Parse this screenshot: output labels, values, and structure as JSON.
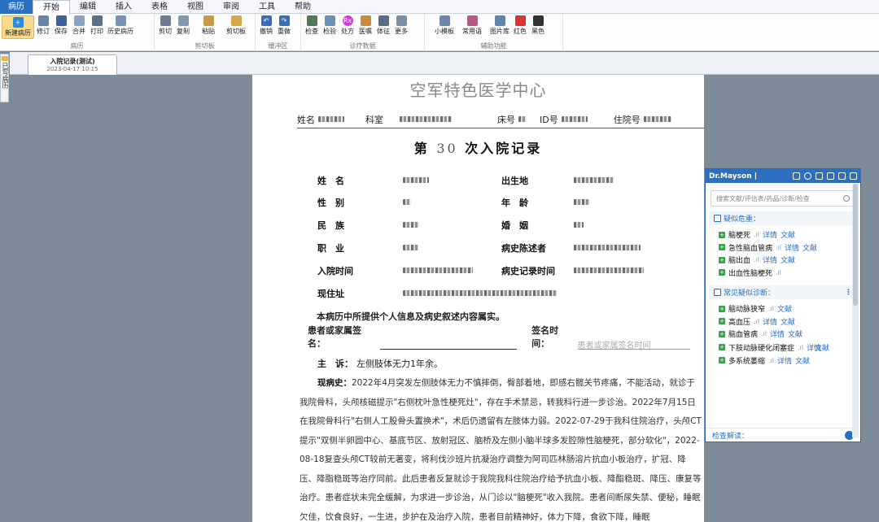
{
  "menubar": {
    "file_tab": "病历",
    "menus": [
      "开始",
      "编辑",
      "插入",
      "表格",
      "视图",
      "审阅",
      "工具",
      "帮助"
    ]
  },
  "ribbon": {
    "groups": [
      {
        "label": "病历",
        "buttons": [
          "新建病历",
          "修订",
          "保存",
          "合并",
          "打印",
          "历史病历"
        ]
      },
      {
        "label": "剪切板",
        "buttons": [
          "剪切",
          "复制",
          "粘贴",
          "剪切板"
        ]
      },
      {
        "label": "缓冲区",
        "buttons": [
          "撤销",
          "重做"
        ]
      },
      {
        "label": "诊疗数据",
        "buttons": [
          "检查",
          "检验",
          "处方",
          "医嘱",
          "体征",
          "更多"
        ]
      },
      {
        "label": "辅助功能",
        "buttons": [
          "小模板",
          "常用语",
          "图片库",
          "红色",
          "黑色"
        ]
      }
    ]
  },
  "left_tab": {
    "label": "已写病历"
  },
  "doc_tab": {
    "title": "入院记录(测试)",
    "subtitle": "2023-04-17 10:15"
  },
  "document": {
    "hospital": "空军特色医学中心",
    "info_labels": {
      "name": "姓名",
      "dept": "科室",
      "bed": "床号",
      "id": "ID号",
      "inpatient": "住院号"
    },
    "admit_title_prefix": "第",
    "admit_number": "30",
    "admit_title_suffix": "次入院记录",
    "fields_left": [
      "姓　名",
      "性　别",
      "民　族",
      "职　业",
      "入院时间",
      "现住址"
    ],
    "fields_right": [
      "出生地",
      "年　龄",
      "婚　姻",
      "病史陈述者",
      "病史记录时间"
    ],
    "declaration": "本病历中所提供个人信息及病史叙述内容属实。",
    "sign_label": "患者或家属签名：",
    "sign_time_label": "签名时间：",
    "sign_time_placeholder": "患者或家属签名时间",
    "chief_label": "主　诉：",
    "chief_value": "左侧肢体无力1年余。",
    "history_label": "现病史：",
    "history_text": "2022年4月突发左侧肢体无力不慎摔倒，臀部着地，即感右髋关节疼痛，不能活动，就诊于我院骨科，头颅核磁提示\"右侧枕叶急性梗死灶\"，存在手术禁忌，转我科行进一步诊治。2022年7月15日在我院骨科行\"右侧人工股骨头置换术\"，术后仍遗留有左肢体力弱。2022-07-29于我科住院治疗，头颅CT提示\"双侧半卵圆中心、基底节区、放射冠区、脑桥及左侧小脑半球多发腔隙性脑梗死，部分软化\"，2022-08-18复查头颅CT较前无著变，将利伐沙班片抗凝治疗调整为阿司匹林肠溶片抗血小板治疗，扩冠、降压、降脂稳斑等治疗同前。此后患者反复就诊于我院我科住院治疗给予抗血小板、降酯稳斑、降压、康复等治疗。患者症状未完全缓解，为求进一步诊治，从门诊以\"脑梗死\"收入我院。患者间断尿失禁、便秘，睡眠欠佳，饮食良好，一生进，步护在及治疗入院，患者目前精神好，体力下降，食欲下降，睡眠"
  },
  "panel": {
    "brand": "Dr.Mayson |",
    "search_placeholder": "搜索文献/评估表/药品/诊断/检查",
    "section1": "疑似危重：",
    "section1_items": [
      {
        "name": "脑梗死",
        "links": [
          "详情",
          "文献"
        ]
      },
      {
        "name": "急性脑血管病",
        "links": [
          "详情",
          "文献"
        ]
      },
      {
        "name": "脑出血",
        "links": [
          "详情",
          "文献"
        ]
      },
      {
        "name": "出血性脑梗死",
        "links": []
      }
    ],
    "section2": "常见疑似诊断：",
    "section2_items": [
      {
        "name": "脑动脉狭窄",
        "links": [
          "文献"
        ]
      },
      {
        "name": "高血压",
        "links": [
          "详情",
          "文献"
        ]
      },
      {
        "name": "脑血管病",
        "links": [
          "详情",
          "文献"
        ]
      },
      {
        "name": "下肢动脉硬化闭塞症",
        "links": [
          "详情",
          "文献"
        ]
      },
      {
        "name": "多系统萎缩",
        "links": [
          "详情",
          "文献"
        ]
      }
    ],
    "footer": "检查解读：",
    "more_symbol": "⋮"
  }
}
